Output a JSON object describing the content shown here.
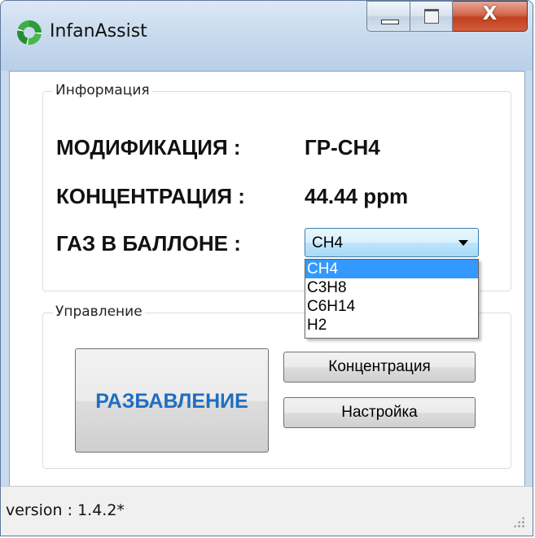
{
  "window": {
    "title": "InfanAssist",
    "close_glyph": "X"
  },
  "info": {
    "group_label": "Информация",
    "modification_label": "МОДИФИКАЦИЯ  :",
    "modification_value": "ГР-СН4",
    "concentration_label": "КОНЦЕНТРАЦИЯ :",
    "concentration_value": "44.44 ppm",
    "gas_label": "ГАЗ В БАЛЛОНЕ  :",
    "gas_selected": "CH4",
    "gas_options": [
      "CH4",
      "C3H8",
      "C6H14",
      "H2"
    ]
  },
  "control": {
    "group_label": "Управление",
    "dilute_button": "РАЗБАВЛЕНИЕ",
    "concentration_button": "Концентрация",
    "setup_button": "Настройка"
  },
  "status": {
    "version": "version : 1.4.2*"
  },
  "icons": {
    "app": "app-logo-icon",
    "minimize": "minimize-icon",
    "maximize": "maximize-icon",
    "close": "close-icon",
    "dropdown": "chevron-down-icon",
    "grip": "resize-grip-icon"
  },
  "colors": {
    "accent": "#1f6ec0",
    "selection": "#3399ff",
    "close_button": "#c1401f"
  }
}
